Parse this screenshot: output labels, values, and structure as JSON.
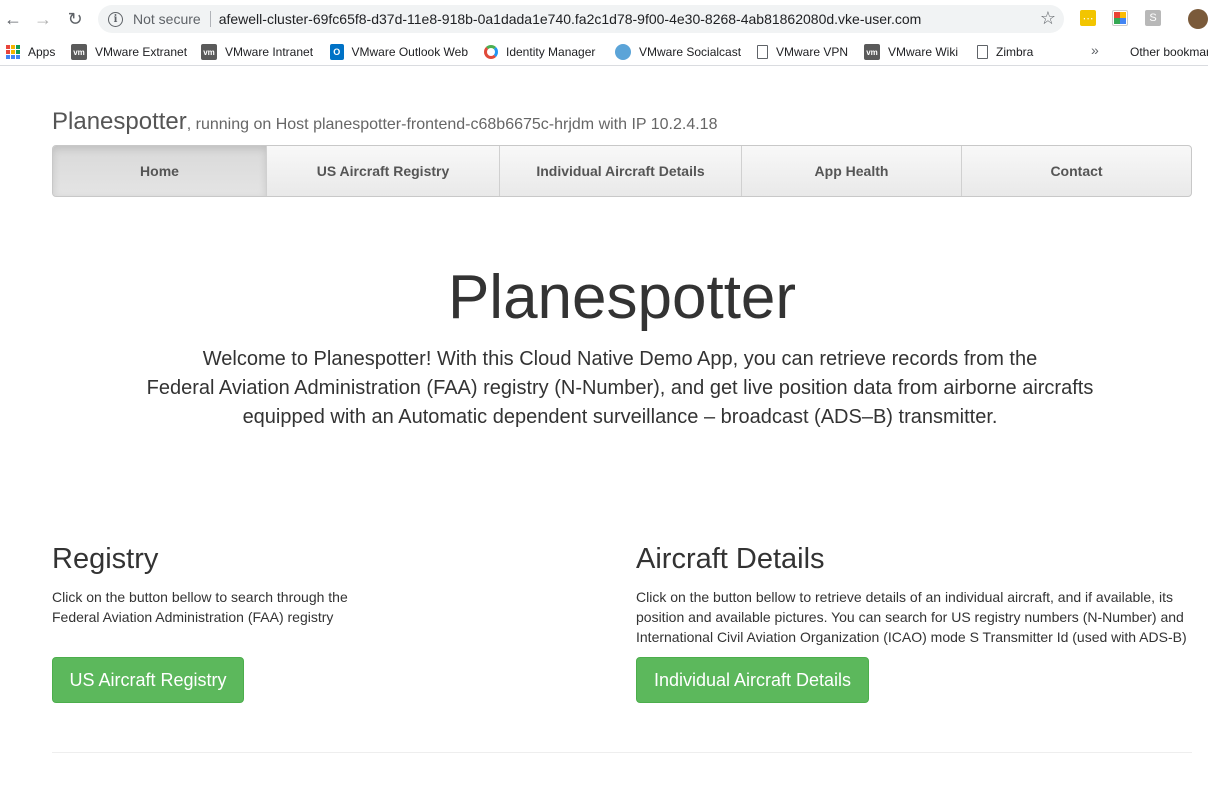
{
  "browser": {
    "security_label": "Not secure",
    "url": "afewell-cluster-69fc65f8-d37d-11e8-918b-0a1dada1e740.fa2c1d78-9f00-4e30-8268-4ab81862080d.vke-user.com",
    "bookmarks": [
      {
        "label": "Apps",
        "icon": "apps-grid-icon"
      },
      {
        "label": "VMware Extranet",
        "icon": "vmware-icon"
      },
      {
        "label": "VMware Intranet",
        "icon": "vmware-icon"
      },
      {
        "label": "VMware Outlook Web",
        "icon": "outlook-icon"
      },
      {
        "label": "Identity Manager",
        "icon": "identity-manager-icon"
      },
      {
        "label": "VMware Socialcast",
        "icon": "socialcast-icon"
      },
      {
        "label": "VMware VPN",
        "icon": "document-icon"
      },
      {
        "label": "VMware Wiki",
        "icon": "vmware-icon"
      },
      {
        "label": "Zimbra",
        "icon": "document-icon"
      }
    ],
    "more_label": "»",
    "other_bookmarks": "Other bookmarks"
  },
  "header": {
    "brand": "Planespotter",
    "subtitle": ", running on Host planespotter-frontend-c68b6675c-hrjdm with IP 10.2.4.18"
  },
  "nav": {
    "items": [
      {
        "label": "Home",
        "active": true
      },
      {
        "label": "US Aircraft Registry",
        "active": false
      },
      {
        "label": "Individual Aircraft Details",
        "active": false
      },
      {
        "label": "App Health",
        "active": false
      },
      {
        "label": "Contact",
        "active": false
      }
    ]
  },
  "hero": {
    "title": "Planespotter",
    "line1": "Welcome to Planespotter! With this Cloud Native Demo App, you can retrieve records from the",
    "line2": "Federal Aviation Administration (FAA) registry (N-Number), and get live position data from airborne aircrafts",
    "line3": "equipped with an Automatic dependent surveillance – broadcast (ADS–B) transmitter."
  },
  "registry": {
    "title": "Registry",
    "line1": "Click on the button bellow to search through the",
    "line2": "Federal Aviation Administration (FAA) registry",
    "button": "US Aircraft Registry"
  },
  "aircraft": {
    "title": "Aircraft Details",
    "line1": "Click on the button bellow to retrieve details of an individual aircraft, and if available, its",
    "line2": "position and available pictures. You can search for US registry numbers (N-Number) and",
    "line3": "International Civil Aviation Organization (ICAO) mode S Transmitter Id (used with ADS-B)",
    "button": "Individual Aircraft Details"
  },
  "colors": {
    "success_button": "#5cb85c",
    "navbar": "#e9e9e9"
  }
}
